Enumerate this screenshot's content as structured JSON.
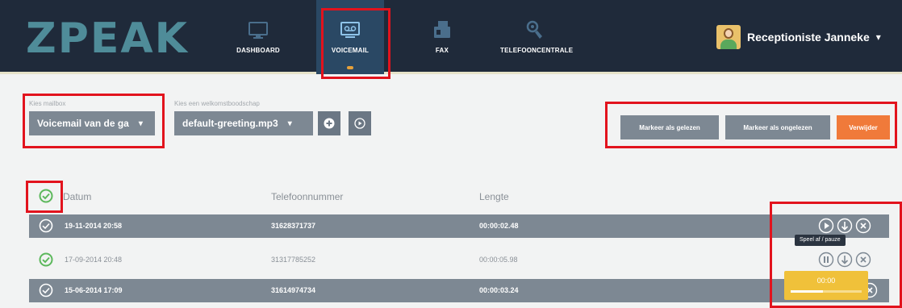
{
  "brand": {
    "logo": "ZPEAK"
  },
  "nav": {
    "items": [
      {
        "label": "DASHBOARD",
        "icon": "monitor-icon",
        "active": false
      },
      {
        "label": "VOICEMAIL",
        "icon": "voicemail-icon",
        "active": true
      },
      {
        "label": "FAX",
        "icon": "fax-icon",
        "active": false
      },
      {
        "label": "TELEFOONCENTRALE",
        "icon": "phone-gear-icon",
        "active": false
      }
    ]
  },
  "user": {
    "name": "Receptioniste Janneke",
    "caret": "▾",
    "avatar": "avatar-icon"
  },
  "controls": {
    "mailbox": {
      "label": "Kies mailbox",
      "value": "Voicemail van de ga"
    },
    "greeting": {
      "label": "Kies een welkomstboodschap",
      "value": "default-greeting.mp3"
    }
  },
  "actions": {
    "mark_read": "Markeer als gelezen",
    "mark_unread": "Markeer als ongelezen",
    "delete": "Verwijder"
  },
  "table": {
    "columns": [
      "Datum",
      "Telefoonnummer",
      "Lengte"
    ],
    "rows": [
      {
        "date": "19-11-2014 20:58",
        "phone": "31628371737",
        "length": "00:00:02.48",
        "state": "read"
      },
      {
        "date": "17-09-2014 20:48",
        "phone": "31317785252",
        "length": "00:00:05.98",
        "state": "unread"
      },
      {
        "date": "15-06-2014 17:09",
        "phone": "31614974734",
        "length": "00:00:03.24",
        "state": "read"
      }
    ]
  },
  "tooltip": {
    "text": "Speel af / pauze"
  },
  "player": {
    "time": "00:00",
    "progress": 0.45
  },
  "colors": {
    "nav_bg": "#1f2a3a",
    "logo": "#4f8c99",
    "row_dark": "#7d8893",
    "delete": "#f07a3a",
    "check_green": "#5cb85c",
    "player": "#f0c13a",
    "highlight": "#e2131d"
  }
}
